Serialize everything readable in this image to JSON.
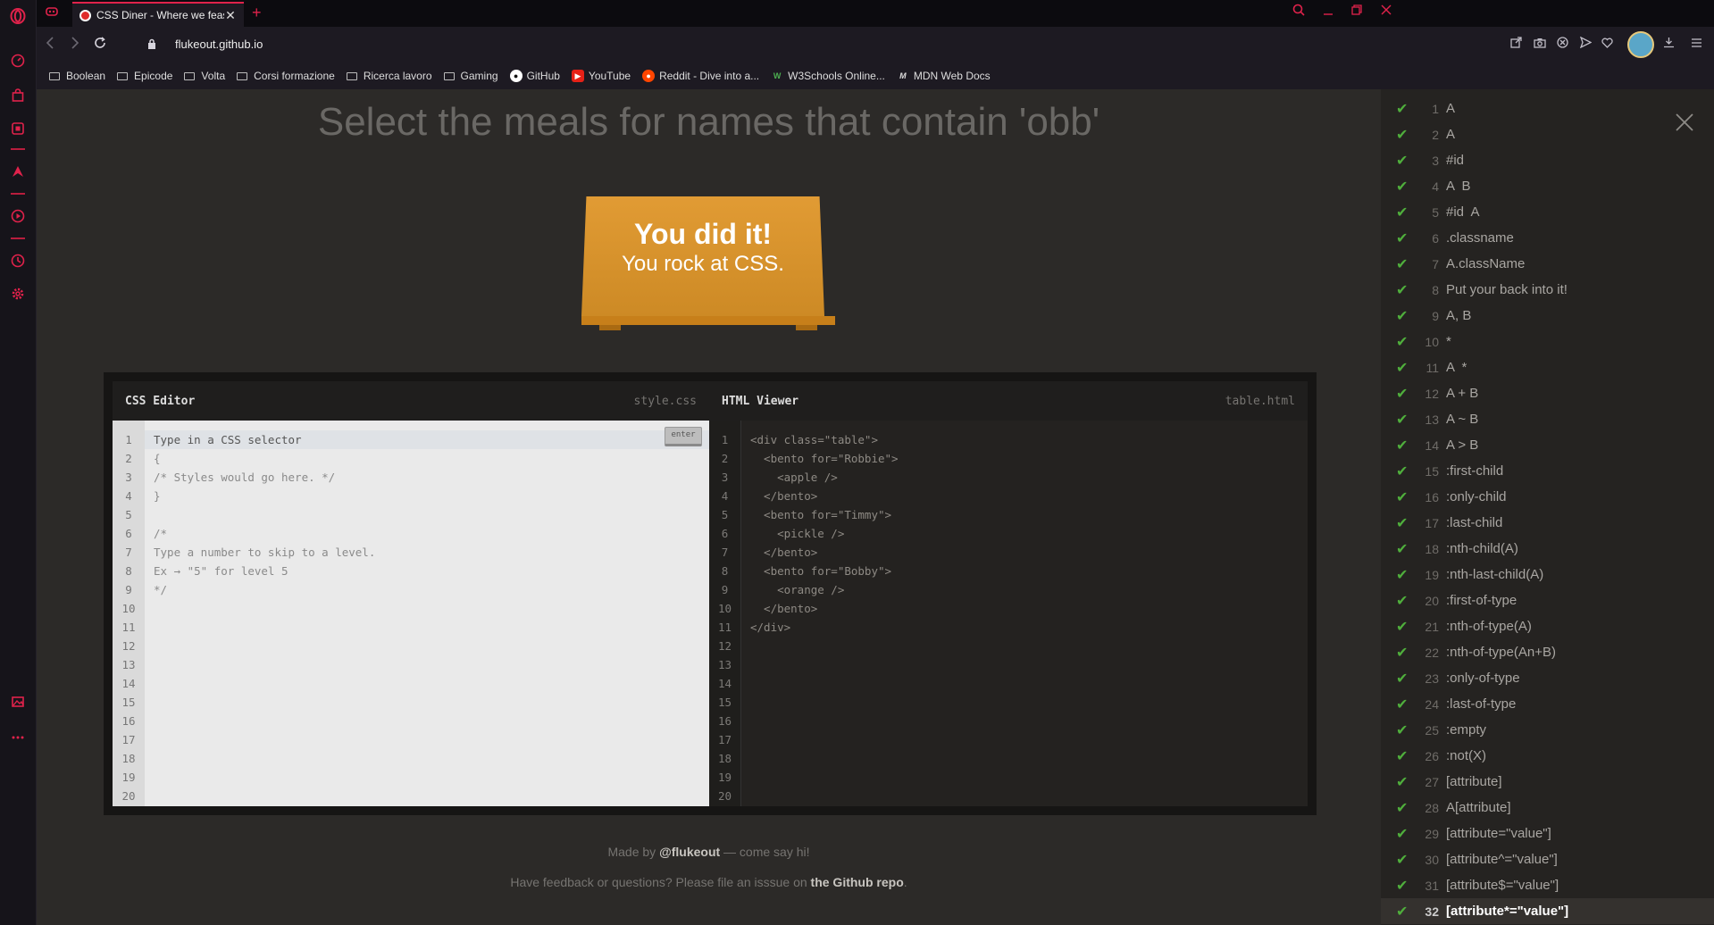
{
  "browser": {
    "tab": {
      "title": "CSS Diner - Where we feast"
    },
    "url": "flukeout.github.io",
    "bookmarks": [
      {
        "label": "Boolean",
        "kind": "folder"
      },
      {
        "label": "Epicode",
        "kind": "folder"
      },
      {
        "label": "Volta",
        "kind": "folder"
      },
      {
        "label": "Corsi formazione",
        "kind": "folder"
      },
      {
        "label": "Ricerca lavoro",
        "kind": "folder"
      },
      {
        "label": "Gaming",
        "kind": "folder"
      },
      {
        "label": "GitHub",
        "kind": "github"
      },
      {
        "label": "YouTube",
        "kind": "youtube"
      },
      {
        "label": "Reddit - Dive into a...",
        "kind": "reddit"
      },
      {
        "label": "W3Schools Online...",
        "kind": "w3"
      },
      {
        "label": "MDN Web Docs",
        "kind": "mdn"
      }
    ]
  },
  "game": {
    "instruction": "Select the meals for names that contain 'obb'",
    "win_line1": "You did it!",
    "win_line2": "You rock at CSS.",
    "css_editor": {
      "title": "CSS Editor",
      "file": "style.css",
      "enter_label": "enter",
      "line_numbers": [
        "1",
        "2",
        "3",
        "4",
        "5",
        "6",
        "7",
        "8",
        "9",
        "10",
        "11",
        "12",
        "13",
        "14",
        "15",
        "16",
        "17",
        "18",
        "19",
        "20"
      ],
      "placeholder": "Type in a CSS selector",
      "lines": [
        "{",
        "/* Styles would go here. */",
        "}",
        "",
        "/*",
        "Type a number to skip to a level.",
        "Ex → \"5\" for level 5",
        "*/"
      ]
    },
    "html_viewer": {
      "title": "HTML Viewer",
      "file": "table.html",
      "line_numbers": [
        "1",
        "2",
        "3",
        "4",
        "5",
        "6",
        "7",
        "8",
        "9",
        "10",
        "11",
        "12",
        "13",
        "14",
        "15",
        "16",
        "17",
        "18",
        "19",
        "20"
      ],
      "lines": [
        "<div class=\"table\">",
        "  <bento for=\"Robbie\">",
        "    <apple />",
        "  </bento>",
        "  <bento for=\"Timmy\">",
        "    <pickle />",
        "  </bento>",
        "  <bento for=\"Bobby\">",
        "    <orange />",
        "  </bento>",
        "</div>"
      ]
    },
    "footer": {
      "made_by_prefix": "Made by",
      "made_by_author": "@flukeout",
      "made_by_suffix": "— come say hi!",
      "feedback_prefix": "Have feedback or questions? Please file an isssue on",
      "feedback_link": "the Github repo",
      "feedback_suffix": "."
    }
  },
  "levels": [
    {
      "num": "1",
      "label": "A"
    },
    {
      "num": "2",
      "label": "A"
    },
    {
      "num": "3",
      "label": "#id"
    },
    {
      "num": "4",
      "label": "A  B"
    },
    {
      "num": "5",
      "label": "#id  A"
    },
    {
      "num": "6",
      "label": ".classname"
    },
    {
      "num": "7",
      "label": "A.className"
    },
    {
      "num": "8",
      "label": "Put your back into it!"
    },
    {
      "num": "9",
      "label": "A, B"
    },
    {
      "num": "10",
      "label": "*"
    },
    {
      "num": "11",
      "label": "A  *"
    },
    {
      "num": "12",
      "label": "A + B"
    },
    {
      "num": "13",
      "label": "A ~ B"
    },
    {
      "num": "14",
      "label": "A > B"
    },
    {
      "num": "15",
      "label": ":first-child"
    },
    {
      "num": "16",
      "label": ":only-child"
    },
    {
      "num": "17",
      "label": ":last-child"
    },
    {
      "num": "18",
      "label": ":nth-child(A)"
    },
    {
      "num": "19",
      "label": ":nth-last-child(A)"
    },
    {
      "num": "20",
      "label": ":first-of-type"
    },
    {
      "num": "21",
      "label": ":nth-of-type(A)"
    },
    {
      "num": "22",
      "label": ":nth-of-type(An+B)"
    },
    {
      "num": "23",
      "label": ":only-of-type"
    },
    {
      "num": "24",
      "label": ":last-of-type"
    },
    {
      "num": "25",
      "label": ":empty"
    },
    {
      "num": "26",
      "label": ":not(X)"
    },
    {
      "num": "27",
      "label": "[attribute]"
    },
    {
      "num": "28",
      "label": "A[attribute]"
    },
    {
      "num": "29",
      "label": "[attribute=\"value\"]"
    },
    {
      "num": "30",
      "label": "[attribute^=\"value\"]"
    },
    {
      "num": "31",
      "label": "[attribute$=\"value\"]"
    },
    {
      "num": "32",
      "label": "[attribute*=\"value\"]",
      "current": true
    }
  ],
  "colors": {
    "accent": "#e0224b",
    "check": "#4fae3c",
    "table": "#e19b34"
  }
}
